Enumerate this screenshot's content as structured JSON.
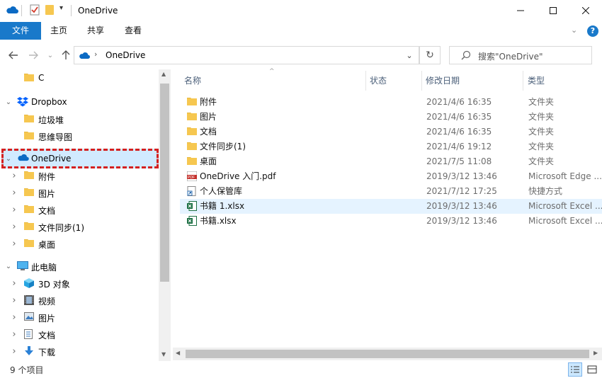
{
  "window": {
    "title": "OneDrive"
  },
  "ribbon": {
    "tabs": [
      "文件",
      "主页",
      "共享",
      "查看"
    ]
  },
  "address": {
    "location": "OneDrive"
  },
  "search": {
    "placeholder": "搜索\"OneDrive\""
  },
  "nav": {
    "items": [
      {
        "label": "C",
        "icon": "folder-icon",
        "level": 1,
        "expander": ""
      },
      {
        "label": "Dropbox",
        "icon": "dropbox-icon",
        "level": 0,
        "expander": "expanded"
      },
      {
        "label": "垃圾堆",
        "icon": "folder-icon",
        "level": 1,
        "expander": ""
      },
      {
        "label": "思维导图",
        "icon": "folder-icon",
        "level": 1,
        "expander": ""
      },
      {
        "label": "OneDrive",
        "icon": "onedrive-icon",
        "level": 0,
        "expander": "expanded",
        "selected": true
      },
      {
        "label": "附件",
        "icon": "folder-icon",
        "level": 1,
        "expander": "collapsed"
      },
      {
        "label": "图片",
        "icon": "folder-icon",
        "level": 1,
        "expander": "collapsed"
      },
      {
        "label": "文档",
        "icon": "folder-icon",
        "level": 1,
        "expander": "collapsed"
      },
      {
        "label": "文件同步(1)",
        "icon": "folder-icon",
        "level": 1,
        "expander": "collapsed"
      },
      {
        "label": "桌面",
        "icon": "folder-icon",
        "level": 1,
        "expander": "collapsed"
      },
      {
        "label": "此电脑",
        "icon": "computer-icon",
        "level": 0,
        "expander": "expanded"
      },
      {
        "label": "3D 对象",
        "icon": "3d-objects-icon",
        "level": 1,
        "expander": "collapsed"
      },
      {
        "label": "视频",
        "icon": "video-icon",
        "level": 1,
        "expander": "collapsed"
      },
      {
        "label": "图片",
        "icon": "pictures-icon",
        "level": 1,
        "expander": "collapsed"
      },
      {
        "label": "文档",
        "icon": "documents-icon",
        "level": 1,
        "expander": "collapsed"
      },
      {
        "label": "下载",
        "icon": "download-icon",
        "level": 1,
        "expander": "collapsed"
      }
    ]
  },
  "columns": {
    "name": "名称",
    "status": "状态",
    "modified": "修改日期",
    "type": "类型"
  },
  "files": [
    {
      "name": "附件",
      "modified": "2021/4/6 16:35",
      "type": "文件夹",
      "icon": "folder-icon"
    },
    {
      "name": "图片",
      "modified": "2021/4/6 16:35",
      "type": "文件夹",
      "icon": "folder-icon"
    },
    {
      "name": "文档",
      "modified": "2021/4/6 16:35",
      "type": "文件夹",
      "icon": "folder-icon"
    },
    {
      "name": "文件同步(1)",
      "modified": "2021/4/6 19:12",
      "type": "文件夹",
      "icon": "folder-icon"
    },
    {
      "name": "桌面",
      "modified": "2021/7/5 11:08",
      "type": "文件夹",
      "icon": "folder-icon"
    },
    {
      "name": "OneDrive 入门.pdf",
      "modified": "2019/3/12 13:46",
      "type": "Microsoft Edge ...",
      "icon": "pdf-icon"
    },
    {
      "name": "个人保管库",
      "modified": "2021/7/12 17:25",
      "type": "快捷方式",
      "icon": "shortcut-icon"
    },
    {
      "name": "书籍 1.xlsx",
      "modified": "2019/3/12 13:46",
      "type": "Microsoft Excel ...",
      "icon": "excel-icon",
      "selected": true
    },
    {
      "name": "书籍.xlsx",
      "modified": "2019/3/12 13:46",
      "type": "Microsoft Excel ...",
      "icon": "excel-icon"
    }
  ],
  "status": {
    "item_count": "9 个项目"
  },
  "colors": {
    "accent": "#1979ca",
    "selection": "#cce8ff",
    "hover": "#e5f3ff",
    "highlight_border": "#d42020"
  }
}
